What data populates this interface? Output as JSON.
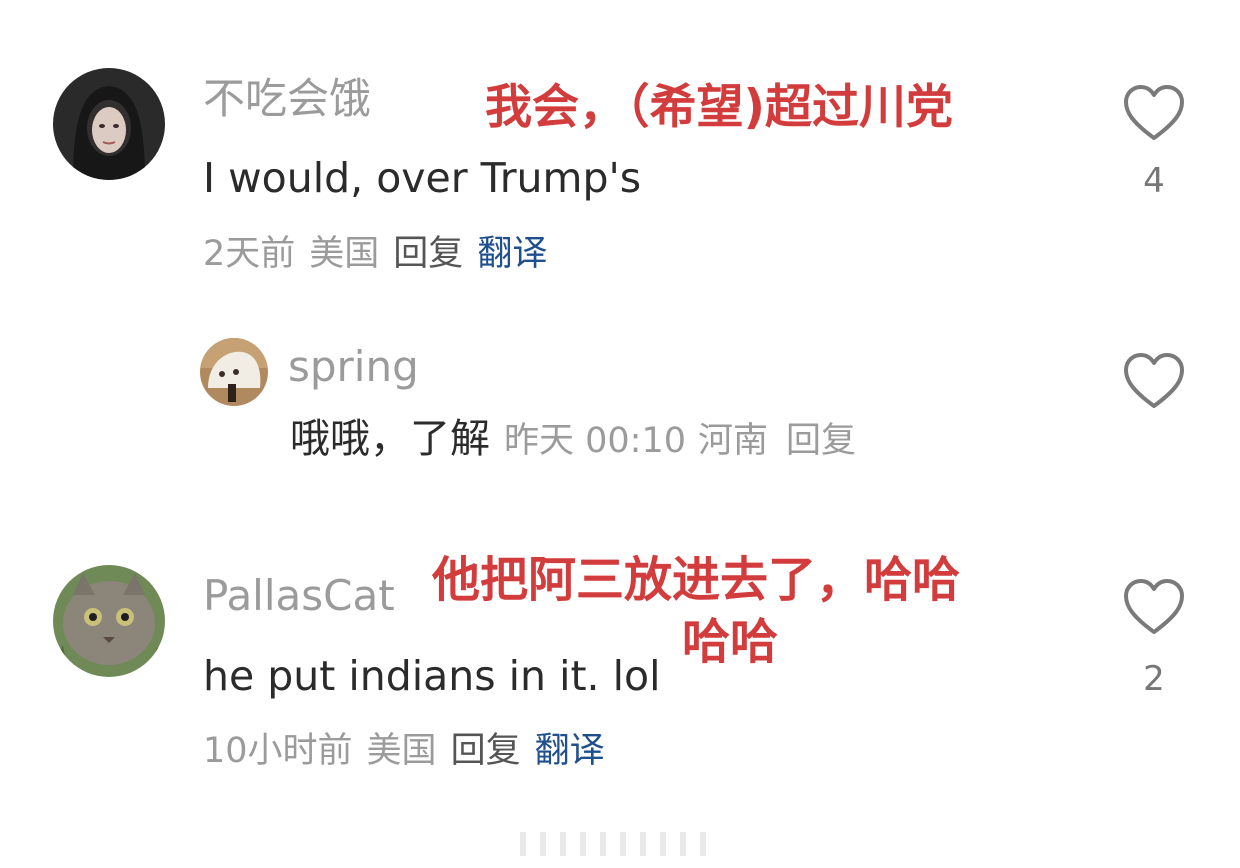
{
  "comments": [
    {
      "username": "不吃会饿",
      "text": "I would, over Trump's",
      "time": "2天前",
      "location": "美国",
      "reply_label": "回复",
      "translate_label": "翻译",
      "likes": "4",
      "annotation": "我会，（希望)超过川党"
    },
    {
      "username": "spring",
      "text": "哦哦，了解",
      "time": "昨天 00:10",
      "location": "河南",
      "reply_label": "回复",
      "likes": ""
    },
    {
      "username": "PallasCat",
      "text": "he put indians in it. lol",
      "time": "10小时前",
      "location": "美国",
      "reply_label": "回复",
      "translate_label": "翻译",
      "likes": "2",
      "annotation_line1": "他把阿三放进去了，哈哈",
      "annotation_line2": "哈哈"
    }
  ],
  "icons": {
    "like": "heart-outline-icon"
  },
  "colors": {
    "annotation": "#d23c3c",
    "translate": "#1f4f8c",
    "username": "#9b9b9b"
  }
}
